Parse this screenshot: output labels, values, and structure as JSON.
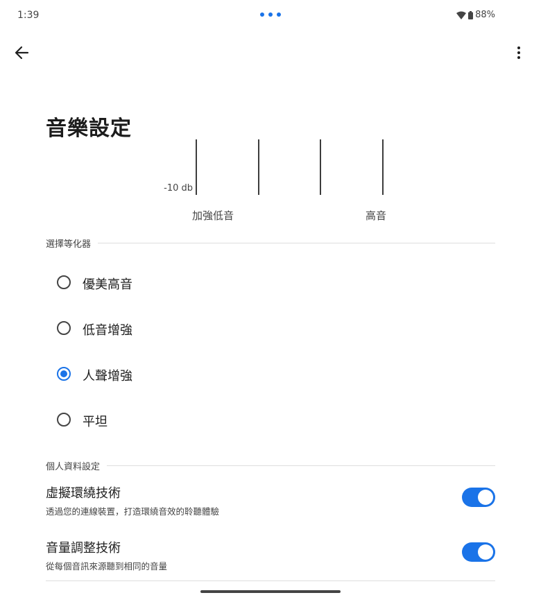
{
  "status_bar": {
    "time": "1:39",
    "battery": "88%"
  },
  "header": {
    "title": "音樂設定"
  },
  "equalizer": {
    "db_label": "-10 db",
    "low_label": "加強低音",
    "high_label": "高音"
  },
  "eq_section": {
    "label": "選擇等化器",
    "options": [
      {
        "label": "優美高音",
        "selected": false
      },
      {
        "label": "低音增強",
        "selected": false
      },
      {
        "label": "人聲增強",
        "selected": true
      },
      {
        "label": "平坦",
        "selected": false
      }
    ]
  },
  "profile_section": {
    "label": "個人資料設定",
    "toggles": [
      {
        "title": "虛擬環繞技術",
        "subtitle": "透過您的連線裝置，打造環繞音效的聆聽體驗",
        "on": true
      },
      {
        "title": "音量調整技術",
        "subtitle": "從每個音訊來源聽到相同的音量",
        "on": true
      }
    ]
  },
  "colors": {
    "accent": "#1a73e8",
    "text": "#1f1f1f",
    "secondary_text": "#444444",
    "divider": "#dddddd"
  }
}
